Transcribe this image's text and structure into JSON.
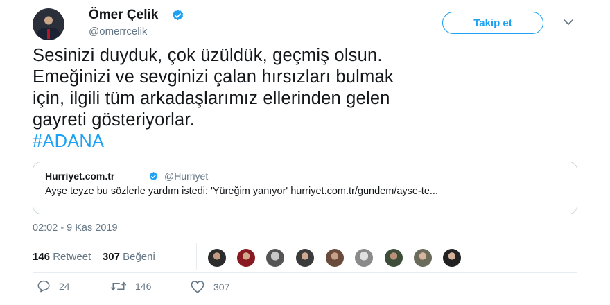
{
  "author": {
    "name": "Ömer Çelik",
    "handle": "@omerrcelik",
    "follow_label": "Takip et"
  },
  "tweet": {
    "lines": [
      "Sesinizi duyduk, çok üzüldük, geçmiş olsun.",
      "Emeğinizi ve sevginizi çalan hırsızları bulmak",
      "için, ilgili tüm arkadaşlarımız ellerinden gelen",
      "gayreti gösteriyorlar."
    ],
    "hashtag": "#ADANA"
  },
  "quote": {
    "name": "Hurriyet.com.tr",
    "handle": "@Hurriyet",
    "text": "Ayşe teyze bu sözlerle yardım istedi: 'Yüreğim yanıyor' hurriyet.com.tr/gundem/ayse-te..."
  },
  "timestamp": "02:02 - 9 Kas 2019",
  "stats": {
    "retweets_count": "146",
    "retweets_label": "Retweet",
    "likes_count": "307",
    "likes_label": "Beğeni"
  },
  "actions": {
    "replies": "24",
    "retweets": "146",
    "likes": "307"
  },
  "colors": {
    "accent": "#1da1f2",
    "secondary_text": "#657786",
    "border": "#ccd6dd"
  },
  "icons": [
    "verified-badge-icon",
    "chevron-down-icon",
    "reply-icon",
    "retweet-icon",
    "heart-icon"
  ]
}
